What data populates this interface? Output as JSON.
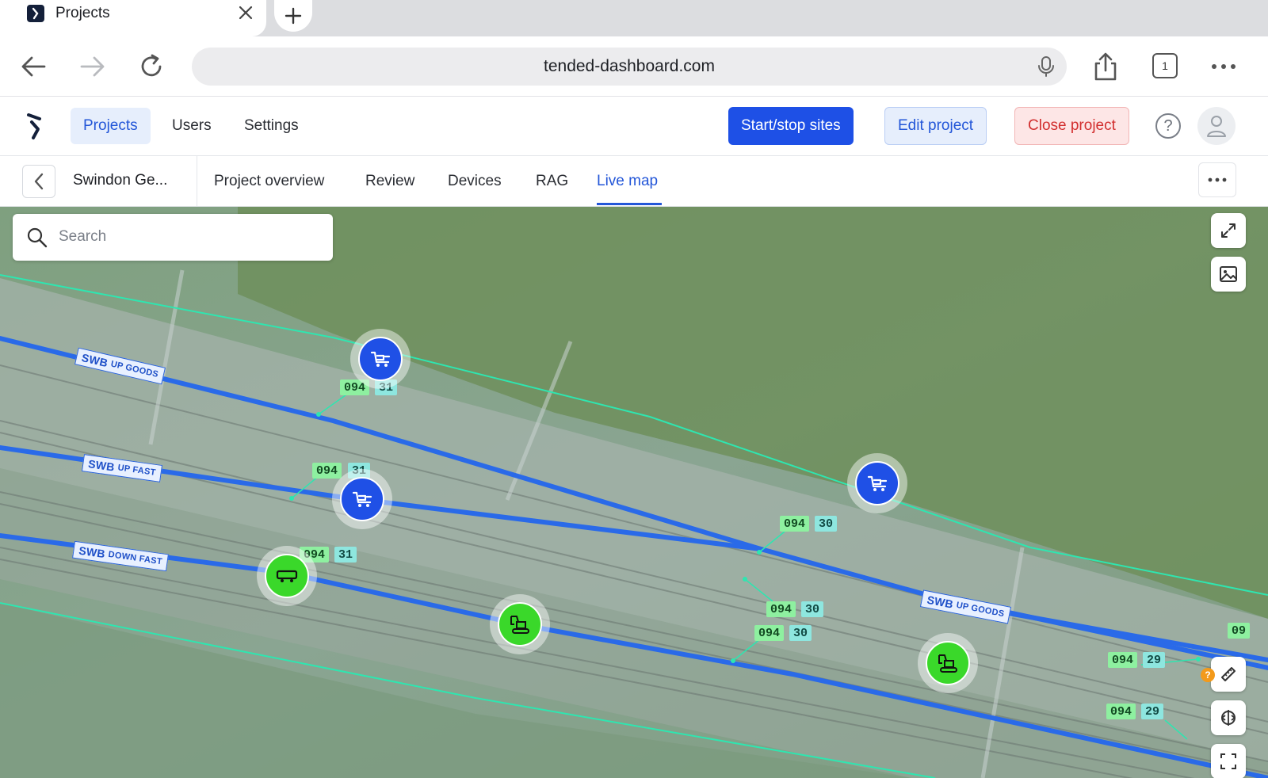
{
  "browser": {
    "tab_title": "Projects",
    "url": "tended-dashboard.com",
    "tab_count": "1",
    "icons": {
      "favicon": "tended-logo-icon",
      "close_tab": "close-icon",
      "new_tab": "plus-icon",
      "back": "arrow-left-icon",
      "forward": "arrow-right-icon",
      "reload": "reload-icon",
      "mic": "microphone-icon",
      "share": "share-icon",
      "tabs": "tabs-icon",
      "menu": "more-horizontal-icon"
    }
  },
  "app": {
    "nav": {
      "projects": "Projects",
      "users": "Users",
      "settings": "Settings"
    },
    "actions": {
      "start_stop": "Start/stop sites",
      "edit": "Edit project",
      "close": "Close project"
    },
    "help_glyph": "?",
    "colors": {
      "primary": "#1e50e6",
      "accent_text": "#2356d8",
      "danger": "#d22f2f",
      "marker_blue": "#1f50e6",
      "marker_green": "#3ad82a",
      "track_line": "#2a6ae8",
      "boundary_line": "#2ee6b0"
    }
  },
  "project": {
    "name": "Swindon Ge...",
    "tabs": [
      "Project overview",
      "Review",
      "Devices",
      "RAG",
      "Live map"
    ],
    "active_tab": "Live map"
  },
  "map": {
    "search_placeholder": "Search",
    "tracks": [
      {
        "prefix": "SWB",
        "name": "UP GOODS"
      },
      {
        "prefix": "SWB",
        "name": "UP FAST"
      },
      {
        "prefix": "SWB",
        "name": "DOWN FAST"
      },
      {
        "prefix": "SWB",
        "name": "UP GOODS"
      }
    ],
    "mileposts": [
      {
        "a": "094",
        "b": "31"
      },
      {
        "a": "094",
        "b": "31"
      },
      {
        "a": "094",
        "b": "31"
      },
      {
        "a": "094",
        "b": "30"
      },
      {
        "a": "094",
        "b": "30"
      },
      {
        "a": "094",
        "b": "30"
      },
      {
        "a": "094",
        "b": "29"
      },
      {
        "a": "094",
        "b": "29"
      }
    ],
    "edge_label": "09",
    "warning_glyph": "?",
    "markers": [
      {
        "color": "blue",
        "icon": "trolley-icon"
      },
      {
        "color": "blue",
        "icon": "trolley-icon"
      },
      {
        "color": "blue",
        "icon": "trolley-icon"
      },
      {
        "color": "green",
        "icon": "rail-vehicle-icon"
      },
      {
        "color": "green",
        "icon": "excavator-icon"
      },
      {
        "color": "green",
        "icon": "excavator-icon"
      }
    ],
    "controls": [
      "expand-icon",
      "layers-image-icon",
      "ruler-icon",
      "compare-icon",
      "fit-icon"
    ]
  }
}
